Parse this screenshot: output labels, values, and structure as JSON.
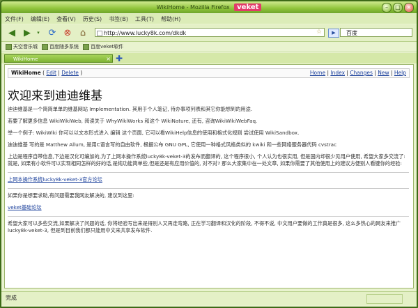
{
  "window": {
    "title": "WikiHome - Mozilla Firefox",
    "brand": "veket"
  },
  "menu": [
    "文件(F)",
    "编辑(E)",
    "查看(V)",
    "历史(S)",
    "书签(B)",
    "工具(T)",
    "帮助(H)"
  ],
  "nav": {
    "url": "http://www.lucky8k.com/dkdk",
    "search_engine": "百度"
  },
  "bookmarks": [
    "天空音乐城",
    "百度随多系统",
    "百度veket软件"
  ],
  "tab": {
    "label": "WikiHome"
  },
  "wiki": {
    "title_bold": "WikiHome",
    "edit": "Edit",
    "delete": "Delete",
    "right_links": [
      "Home",
      "Index",
      "Changes",
      "New",
      "Help"
    ],
    "heading": "欢迎来到迪迪维基",
    "paragraphs": [
      "迪迪维基是一个简简单单的维基网站 Implementation. 其用于个人笔记, 待办事项列表和其它你能想到的用途.",
      "若要了解更多信息 WikiWikiWeb, 阅读关于 WhyWikiWorks 和这个 WikiNature, 还有, 咨询WikiWikiWebFaq.",
      "举一个例子: WikiWiki 你可以以文本形式进入 编辑 这个页面, 它可以看WikiHelp信息的使用和格式化规则 尝试使用 WikiSandbox.",
      "迪迪维基 写的是 Matthew Allum, 是用C语言写的自由软件, 根据公布 GNU GPL, 它使用一种格式风格类似的 kwiki 和一些网络服务器代码 cvstrac",
      "上边是程序自带信息,下边是汉化可编加的,为了上网本操作系统lucky8k-veket-3的发布而翻译的, 这个程序很小, 个人认为也很实用, 但是国内却很少见用户使用, 希望大家多交流了: 就是, 如果有小软件可以实现相同怎样的好的话,是纯功能简单些,但是还是有应用价值的, 对不对? 那么大家集中在一处文章, 如果你需要了其他使用上的建议方便别人看键你的经验:",
      "上网本操作系统lucky8k-veket-3官方论坛",
      "如果你是想要求助,有问题需要我网友解决的, 建议到这里:",
      "veket基础论坛",
      "希望大家可以多些交流,如果解决了问题的话, 你将经验写出来是得别人又再走弯路, 正在学习翻译和汉化的阶段, 不得不说, 中文用户要做的工作真是很多, 这么多热心的网友来推广 lucky8k-veket-3, 但是到目前我们都只能用中文来共享发布软件."
    ]
  },
  "status": {
    "text": "完成"
  }
}
